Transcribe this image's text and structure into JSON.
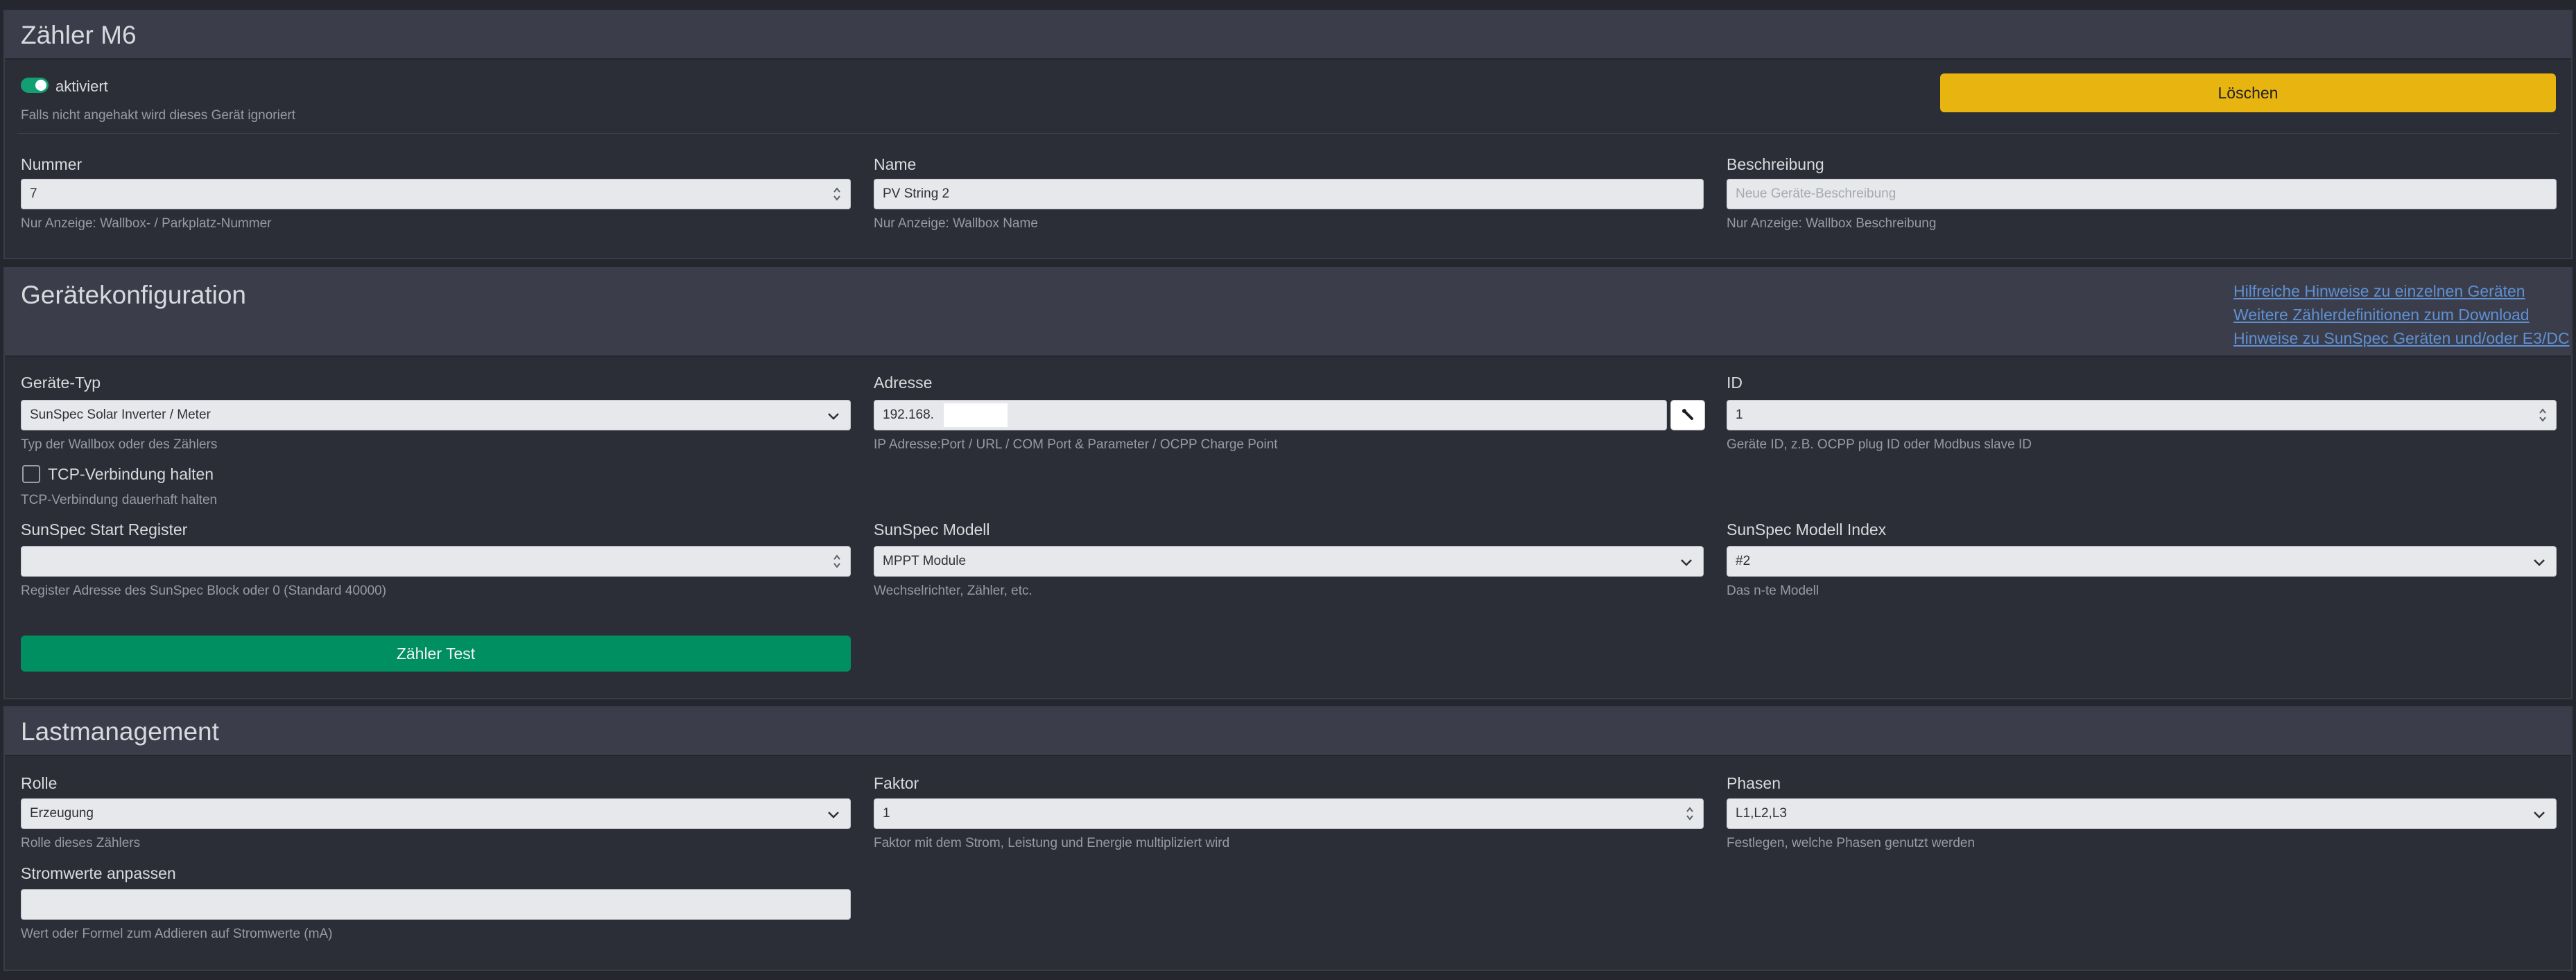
{
  "device": {
    "title": "Zähler M6",
    "enabled_label": "aktiviert",
    "enabled_hint": "Falls nicht angehakt wird dieses Gerät ignoriert",
    "delete_label": "Löschen",
    "number_label": "Nummer",
    "number_value": "7",
    "number_hint": "Nur Anzeige: Wallbox- / Parkplatz-Nummer",
    "name_label": "Name",
    "name_value": "PV String 2",
    "name_hint": "Nur Anzeige: Wallbox Name",
    "desc_label": "Beschreibung",
    "desc_placeholder": "Neue Geräte-Beschreibung",
    "desc_hint": "Nur Anzeige: Wallbox Beschreibung"
  },
  "config": {
    "title": "Gerätekonfiguration",
    "links": [
      "Hilfreiche Hinweise zu einzelnen Geräten",
      "Weitere Zählerdefinitionen zum Download",
      "Hinweise zu SunSpec Geräten und/oder E3/DC"
    ],
    "type_label": "Geräte-Typ",
    "type_value": "SunSpec Solar Inverter / Meter",
    "type_hint": "Typ der Wallbox oder des Zählers",
    "address_label": "Adresse",
    "address_value": "192.168.",
    "address_hint": "IP Adresse:Port / URL / COM Port & Parameter / OCPP Charge Point",
    "id_label": "ID",
    "id_value": "1",
    "id_hint": "Geräte ID, z.B. OCPP plug ID oder Modbus slave ID",
    "tcp_label": "TCP-Verbindung halten",
    "tcp_hint": "TCP-Verbindung dauerhaft halten",
    "start_register_label": "SunSpec Start Register",
    "start_register_value": "",
    "start_register_hint": "Register Adresse des SunSpec Block oder 0 (Standard 40000)",
    "model_label": "SunSpec Modell",
    "model_value": "MPPT Module",
    "model_hint": "Wechselrichter, Zähler, etc.",
    "model_index_label": "SunSpec Modell Index",
    "model_index_value": "#2",
    "model_index_hint": "Das n-te Modell",
    "test_label": "Zähler Test"
  },
  "load": {
    "title": "Lastmanagement",
    "role_label": "Rolle",
    "role_value": "Erzeugung",
    "role_hint": "Rolle dieses Zählers",
    "factor_label": "Faktor",
    "factor_value": "1",
    "factor_hint": "Faktor mit dem Strom, Leistung und Energie multipliziert wird",
    "phases_label": "Phasen",
    "phases_value": "L1,L2,L3",
    "phases_hint": "Festlegen, welche Phasen genutzt werden",
    "current_adjust_label": "Stromwerte anpassen",
    "current_adjust_value": "",
    "current_adjust_hint": "Wert oder Formel zum Addieren auf Stromwerte (mA)"
  },
  "colors": {
    "background": "#25262e",
    "panel": "#2c2e37",
    "header": "#3b3e4a",
    "delete_button": "#e8b40f",
    "test_button": "#008f60",
    "toggle_on": "#12a073",
    "link": "#5e90d4"
  },
  "icons": {
    "toggle": "toggle-switch-icon",
    "spinner": "number-spinner-icon",
    "dropdown": "chevron-down-icon",
    "address_tool": "edit-icon"
  }
}
